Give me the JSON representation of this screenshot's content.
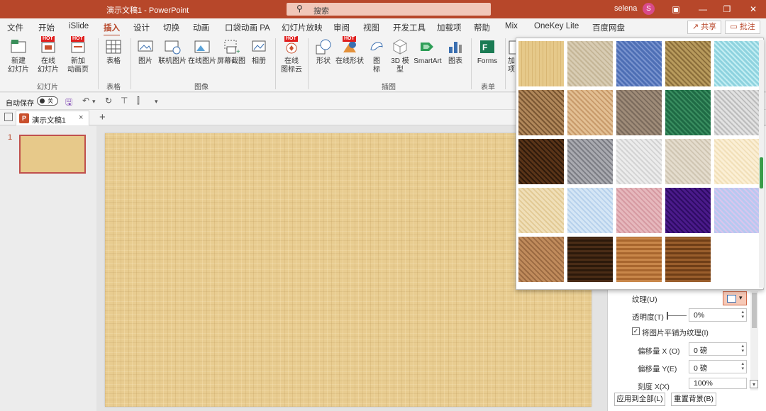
{
  "titlebar": {
    "doc_title": "演示文稿1  -  PowerPoint",
    "search_placeholder": "搜索",
    "user": "selena",
    "avatar_initial": "S"
  },
  "menu": {
    "tabs": [
      "文件",
      "开始",
      "iSlide",
      "插入",
      "设计",
      "切换",
      "动画",
      "口袋动画 PA",
      "幻灯片放映",
      "审阅",
      "视图",
      "开发工具",
      "加载项",
      "帮助",
      "Mix",
      "OneKey Lite",
      "百度网盘"
    ],
    "active": "插入",
    "share": "共享",
    "comment": "批注"
  },
  "ribbon": {
    "new_slide": [
      "新建",
      "幻灯片"
    ],
    "online_slide": [
      "在线",
      "幻灯片"
    ],
    "add_anim_page": [
      "新加",
      "动画页"
    ],
    "group_slides": "幻灯片",
    "table": "表格",
    "group_table": "表格",
    "picture": "图片",
    "online_picture": "联机图片",
    "online_image": "在线图片",
    "screenshot": "屏幕截图",
    "album": "相册",
    "group_image": "图像",
    "icon_cloud": [
      "在线",
      "图标云"
    ],
    "shapes": "形状",
    "online_shapes": "在线形状",
    "icons": [
      "图",
      "标"
    ],
    "model_3d": [
      "3D 模",
      "型"
    ],
    "smartart": "SmartArt",
    "chart": "图表",
    "group_illus": "插图",
    "forms": "Forms",
    "group_forms": "表单",
    "partial": [
      "加",
      "项"
    ],
    "hot": "HOT"
  },
  "qat": {
    "autosave": "自动保存",
    "toggle": "关"
  },
  "doctab": {
    "name": "演示文稿1",
    "close": "×",
    "add": "+"
  },
  "thumbs": {
    "num": "1"
  },
  "pane": {
    "texture_label": "纹理(U)",
    "transparency_label": "透明度(T)",
    "transparency_value": "0%",
    "tile_label": "将图片平铺为纹理(I)",
    "offset_x_label": "偏移量 X (O)",
    "offset_x_value": "0 磅",
    "offset_y_label": "偏移量 Y(E)",
    "offset_y_value": "0 磅",
    "scale_x_label": "刻度 X(X)",
    "scale_x_value": "100%",
    "apply_all": "应用到全部(L)",
    "reset_bg": "重置背景(B)"
  },
  "textures": [
    {
      "name": "papyrus",
      "colors": [
        "#e6c98a",
        "#d9b774"
      ]
    },
    {
      "name": "canvas",
      "colors": [
        "#d8ccb3",
        "#c4b596"
      ]
    },
    {
      "name": "denim",
      "colors": [
        "#4e6fb5",
        "#7a94cf"
      ]
    },
    {
      "name": "woven-mat",
      "colors": [
        "#b79a5c",
        "#8a6d3a"
      ]
    },
    {
      "name": "water-droplets",
      "colors": [
        "#8fd3df",
        "#c3eef3"
      ]
    },
    {
      "name": "paper-bag",
      "colors": [
        "#b0875a",
        "#7a5632"
      ]
    },
    {
      "name": "fish-fossil",
      "colors": [
        "#e2bf93",
        "#c89a6a"
      ]
    },
    {
      "name": "sand",
      "colors": [
        "#9e8b78",
        "#7a6a5c"
      ]
    },
    {
      "name": "green-marble",
      "colors": [
        "#1f6b45",
        "#3a8f61"
      ]
    },
    {
      "name": "white-marble",
      "colors": [
        "#e1e1e1",
        "#bcbcbc"
      ]
    },
    {
      "name": "brown-marble",
      "colors": [
        "#5a3418",
        "#2e1a0b"
      ]
    },
    {
      "name": "granite",
      "colors": [
        "#a9aab0",
        "#7c7d84"
      ]
    },
    {
      "name": "newsprint",
      "colors": [
        "#ececec",
        "#d3d3d3"
      ]
    },
    {
      "name": "recycled-paper",
      "colors": [
        "#e4dccd",
        "#cfc5b2"
      ]
    },
    {
      "name": "parchment",
      "colors": [
        "#fbefd5",
        "#f1dfb8"
      ]
    },
    {
      "name": "stationery",
      "colors": [
        "#f0dfb8",
        "#e2ca95"
      ]
    },
    {
      "name": "blue-tissue-paper",
      "colors": [
        "#d5e6f5",
        "#b7d1ec"
      ]
    },
    {
      "name": "pink-tissue-paper",
      "colors": [
        "#e6b8bd",
        "#d69aa2"
      ]
    },
    {
      "name": "purple-mesh",
      "colors": [
        "#4a1a8a",
        "#2e0b63"
      ]
    },
    {
      "name": "bouquet",
      "colors": [
        "#b7c9f0",
        "#d9c5ee"
      ]
    },
    {
      "name": "cork",
      "colors": [
        "#c08b5c",
        "#9b6a42"
      ]
    },
    {
      "name": "walnut",
      "colors": [
        "#4a2c16",
        "#2c190b"
      ]
    },
    {
      "name": "oak",
      "colors": [
        "#c9874a",
        "#a8662e"
      ]
    },
    {
      "name": "medium-wood",
      "colors": [
        "#9a5e2c",
        "#6f3e17"
      ]
    }
  ]
}
